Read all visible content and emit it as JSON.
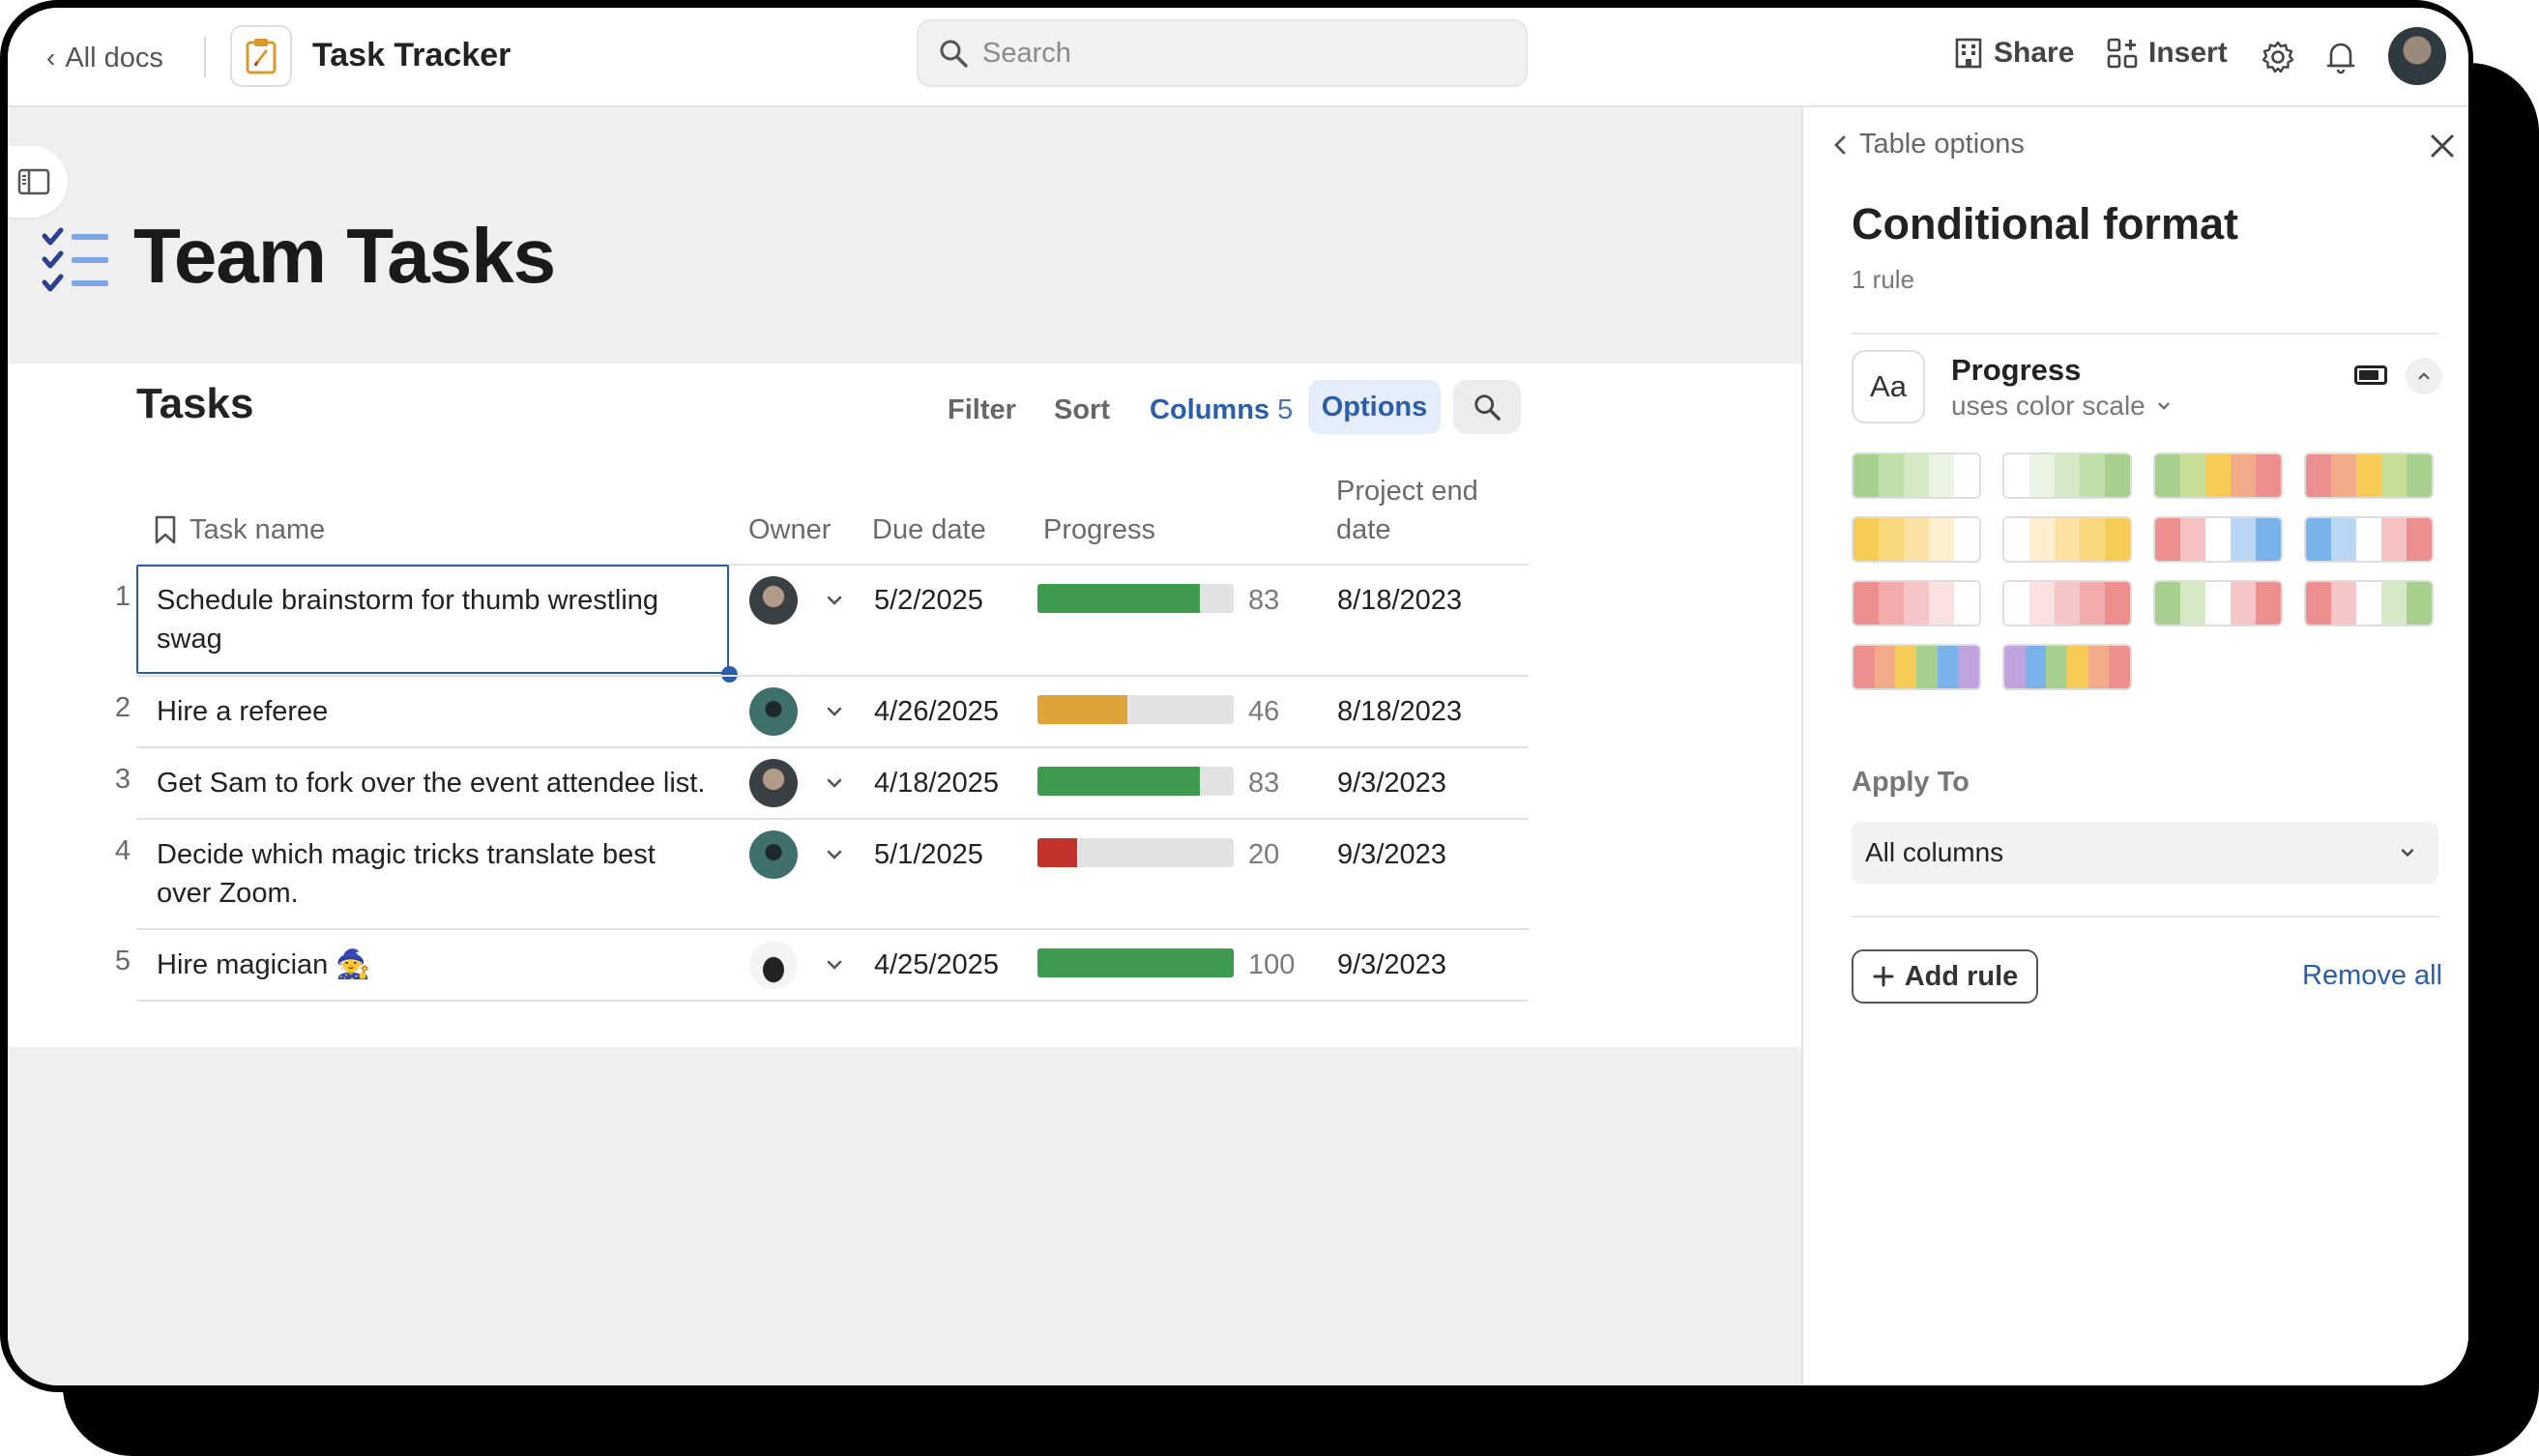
{
  "topbar": {
    "back_label": "All docs",
    "doc_title": "Task Tracker",
    "search_placeholder": "Search",
    "share_label": "Share",
    "insert_label": "Insert"
  },
  "page": {
    "title": "Team Tasks"
  },
  "table": {
    "title": "Tasks",
    "controls": {
      "filter": "Filter",
      "sort": "Sort",
      "columns": "Columns",
      "columns_count": "5",
      "options": "Options"
    },
    "headers": {
      "task_name": "Task name",
      "owner": "Owner",
      "due_date": "Due date",
      "progress": "Progress",
      "project_end_line1": "Project end",
      "project_end_line2": "date"
    },
    "rows": [
      {
        "num": "1",
        "task_line1": "Schedule brainstorm for thumb wrestling",
        "task_line2": "swag",
        "due": "5/2/2025",
        "progress": 83,
        "progress_label": "83",
        "progress_color": "#3d9a4f",
        "end": "8/18/2023"
      },
      {
        "num": "2",
        "task_line1": "Hire a referee",
        "task_line2": "",
        "due": "4/26/2025",
        "progress": 46,
        "progress_label": "46",
        "progress_color": "#e0a33a",
        "end": "8/18/2023"
      },
      {
        "num": "3",
        "task_line1": "Get Sam to fork over the event attendee list.",
        "task_line2": "",
        "due": "4/18/2025",
        "progress": 83,
        "progress_label": "83",
        "progress_color": "#3d9a4f",
        "end": "9/3/2023"
      },
      {
        "num": "4",
        "task_line1": "Decide which magic tricks translate best",
        "task_line2": "over Zoom.",
        "due": "5/1/2025",
        "progress": 20,
        "progress_label": "20",
        "progress_color": "#c3332b",
        "end": "9/3/2023"
      },
      {
        "num": "5",
        "task_line1": "Hire magician 🧙",
        "task_line2": "",
        "due": "4/25/2025",
        "progress": 100,
        "progress_label": "100",
        "progress_color": "#3d9a4f",
        "end": "9/3/2023"
      }
    ]
  },
  "panel": {
    "back_label": "Table options",
    "heading": "Conditional format",
    "rule_count": "1 rule",
    "rule": {
      "icon_text": "Aa",
      "name": "Progress",
      "mode": "uses color scale"
    },
    "palettes": [
      [
        "#a7d08e",
        "#bedda9",
        "#d4e9c5",
        "#ebf4e3",
        "#ffffff"
      ],
      [
        "#ffffff",
        "#ebf4e3",
        "#d4e9c5",
        "#bedda9",
        "#a7d08e"
      ],
      [
        "#a7d08e",
        "#c8dd95",
        "#f7cc56",
        "#f3ab8a",
        "#ee8f8f"
      ],
      [
        "#ee8f8f",
        "#f3ab8a",
        "#f7cc56",
        "#c8dd95",
        "#a7d08e"
      ],
      [
        "#f7cc56",
        "#f9d77d",
        "#fbe2a4",
        "#fdeecf",
        "#ffffff"
      ],
      [
        "#ffffff",
        "#fdeecf",
        "#fbe2a4",
        "#f9d77d",
        "#f7cc56"
      ],
      [
        "#ee8f8f",
        "#f5c0c0",
        "#ffffff",
        "#b9d6f5",
        "#7ab2ea"
      ],
      [
        "#7ab2ea",
        "#b9d6f5",
        "#ffffff",
        "#f5c0c0",
        "#ee8f8f"
      ],
      [
        "#ee8f8f",
        "#f2aaaa",
        "#f6c5c5",
        "#fae0e0",
        "#ffffff"
      ],
      [
        "#ffffff",
        "#fae0e0",
        "#f6c5c5",
        "#f2aaaa",
        "#ee8f8f"
      ],
      [
        "#a7d08e",
        "#d4e9c5",
        "#ffffff",
        "#f6c5c5",
        "#ee8f8f"
      ],
      [
        "#ee8f8f",
        "#f6c5c5",
        "#ffffff",
        "#d4e9c5",
        "#a7d08e"
      ],
      [
        "#ee8f8f",
        "#f3ab8a",
        "#f7cc56",
        "#a7d08e",
        "#7ab2ea",
        "#c0a4e0"
      ],
      [
        "#c0a4e0",
        "#7ab2ea",
        "#a7d08e",
        "#f7cc56",
        "#f3ab8a",
        "#ee8f8f"
      ]
    ],
    "apply_to_label": "Apply To",
    "apply_to_value": "All columns",
    "add_rule_label": "Add rule",
    "remove_all_label": "Remove all"
  },
  "colors": {
    "accent_blue": "#2a5ea8",
    "progress_green": "#3d9a4f",
    "progress_yellow": "#e0a33a",
    "progress_red": "#c3332b"
  }
}
